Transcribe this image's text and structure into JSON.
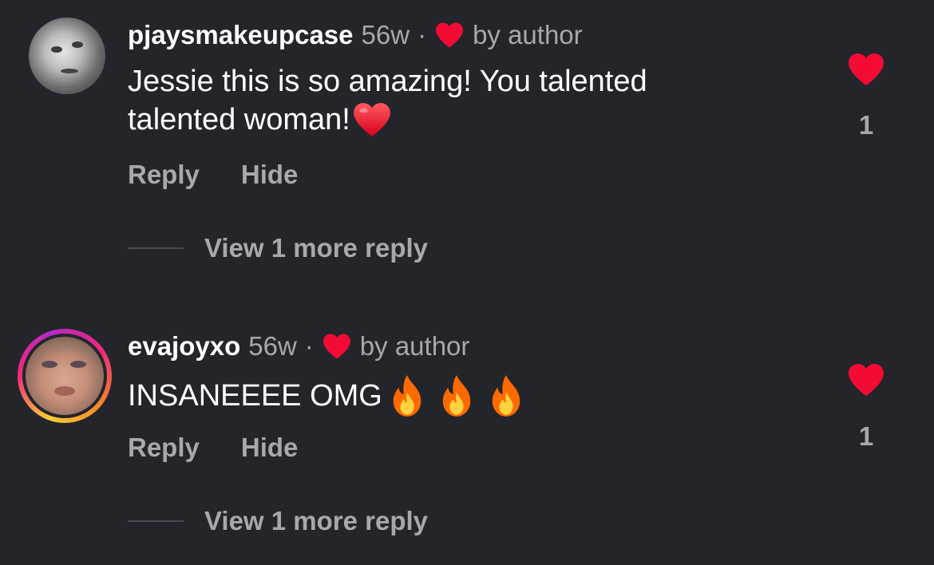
{
  "colors": {
    "background": "#24252b",
    "heart_red": "#f30b34",
    "muted_text": "#a8a8a8",
    "story_ring": "#ee2a7b"
  },
  "comments": [
    {
      "username": "pjaysmakeupcase",
      "age": "56w",
      "separator": "·",
      "liked_by": "by author",
      "body_line1": "Jessie this is so amazing! You talented",
      "body_line2": "talented woman!",
      "emoji": "red-heart-emoji",
      "reply_label": "Reply",
      "hide_label": "Hide",
      "view_more_label": "View 1 more reply",
      "like_count": "1",
      "avatar": "grayscale-photo"
    },
    {
      "username": "evajoyxo",
      "age": "56w",
      "separator": "·",
      "liked_by": "by author",
      "body": "INSANEEEE OMG",
      "emoji": "fire-emoji",
      "reply_label": "Reply",
      "hide_label": "Hide",
      "view_more_label": "View 1 more reply",
      "like_count": "1",
      "avatar": "story-ring-photo"
    }
  ]
}
